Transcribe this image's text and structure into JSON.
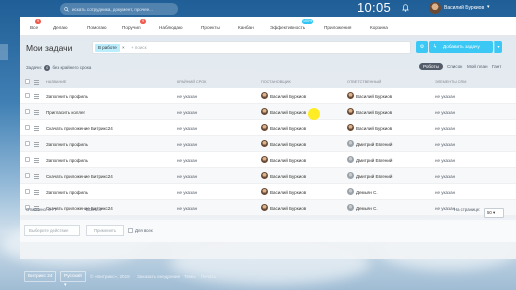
{
  "search": {
    "placeholder": "искать сотрудника, документ, прочее..."
  },
  "clock": "10:05",
  "user": {
    "name": "Василий Буркиов"
  },
  "nav": {
    "items": [
      {
        "label": "Все",
        "badge": "9"
      },
      {
        "label": "Делаю",
        "badge": ""
      },
      {
        "label": "Помогаю",
        "badge": ""
      },
      {
        "label": "Поручил",
        "badge": "9"
      },
      {
        "label": "Наблюдаю",
        "badge": ""
      },
      {
        "label": "Проекты",
        "badge": ""
      },
      {
        "label": "Канбан",
        "badge": ""
      },
      {
        "label": "Эффективность",
        "badge": "100%"
      },
      {
        "label": "Приложения",
        "badge": ""
      },
      {
        "label": "Корзина",
        "badge": ""
      }
    ]
  },
  "page": {
    "title": "Мои задачи",
    "filter_tag": "В работе",
    "filter_placeholder": "+ поиск",
    "add_button": "Добавить задачу"
  },
  "counters": {
    "label": "Задачи:",
    "count": "0",
    "text": "без крайнего срока"
  },
  "views": [
    "Роботы",
    "Список",
    "Мой план",
    "Гант"
  ],
  "grid": {
    "columns": [
      "Название",
      "Крайний срок",
      "Постановщик",
      "Ответственный",
      "Элементы CRM"
    ],
    "rows": [
      {
        "name": "Заполнить профиль",
        "deadline": "не указан",
        "creator": "Василий Буркиов",
        "responsible": "Василий Буркиов",
        "crm": "не указан",
        "resp_avatar": "m"
      },
      {
        "name": "Пригласить коллег",
        "deadline": "не указан",
        "creator": "Василий Буркиов",
        "responsible": "Василий Буркиов",
        "crm": "не указан",
        "resp_avatar": "m"
      },
      {
        "name": "Скачать приложение Битрикс24",
        "deadline": "не указан",
        "creator": "Василий Буркиов",
        "responsible": "Василий Буркиов",
        "crm": "не указан",
        "resp_avatar": "m"
      },
      {
        "name": "Заполнить профиль",
        "deadline": "не указан",
        "creator": "Василий Буркиов",
        "responsible": "Дмитрий Евгений",
        "crm": "не указан",
        "resp_avatar": "e"
      },
      {
        "name": "Заполнить профиль",
        "deadline": "не указан",
        "creator": "Василий Буркиов",
        "responsible": "Дмитрий Евгений",
        "crm": "не указан",
        "resp_avatar": "e"
      },
      {
        "name": "Скачать приложение Битрикс24",
        "deadline": "не указан",
        "creator": "Василий Буркиов",
        "responsible": "Дмитрий Евгений",
        "crm": "не указан",
        "resp_avatar": "e"
      },
      {
        "name": "Заполнить профиль",
        "deadline": "не указан",
        "creator": "Василий Буркиов",
        "responsible": "Демьян С.",
        "crm": "не указан",
        "resp_avatar": "e"
      },
      {
        "name": "Скачать приложение Битрикс24",
        "deadline": "не указан",
        "creator": "Василий Буркиов",
        "responsible": "Демьян С.",
        "crm": "не указан",
        "resp_avatar": "e"
      }
    ]
  },
  "grid_footer": {
    "selected": "Отмечено: 0 / 7",
    "total": "Всего: 7",
    "per_page_label": "На странице:",
    "per_page": "50"
  },
  "actions": {
    "select_placeholder": "Выберите действие",
    "apply": "Применить",
    "for_all": "Для всех"
  },
  "footer": {
    "brand": "Битрикс 24",
    "lang": "Русский",
    "copyright": "© «Битрикс», 2019",
    "links": [
      "Заказать внедрение",
      "Темы",
      "Печать"
    ]
  },
  "colors": {
    "accent": "#3bc8f5",
    "badge_red": "#f05a4e",
    "text": "#333333"
  }
}
